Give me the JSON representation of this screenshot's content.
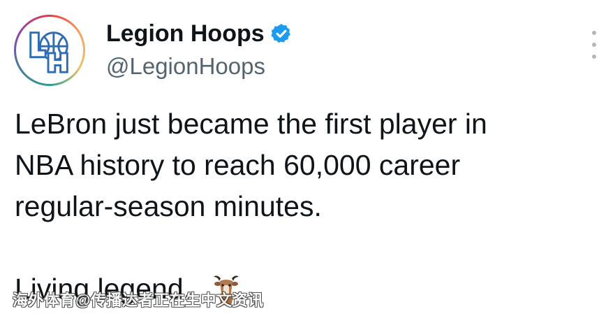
{
  "account": {
    "display_name": "Legion Hoops",
    "handle": "@LegionHoops",
    "avatar_monogram": "LH",
    "verified_icon": "verified-badge-icon"
  },
  "tweet": {
    "lines": [
      "LeBron just became the first player in",
      "NBA history to reach 60,000 career",
      "regular-season minutes."
    ],
    "closing": "Living legend.",
    "emoji": "goat-emoji"
  },
  "menu": {
    "icon": "more-options-icon"
  },
  "watermark": {
    "text": "海外体育@传播达者正在生中文资讯"
  },
  "colors": {
    "text_primary": "#0f1419",
    "text_secondary": "#536471",
    "verified_blue": "#1d9bf0",
    "avatar_blue": "#2f6db3"
  }
}
